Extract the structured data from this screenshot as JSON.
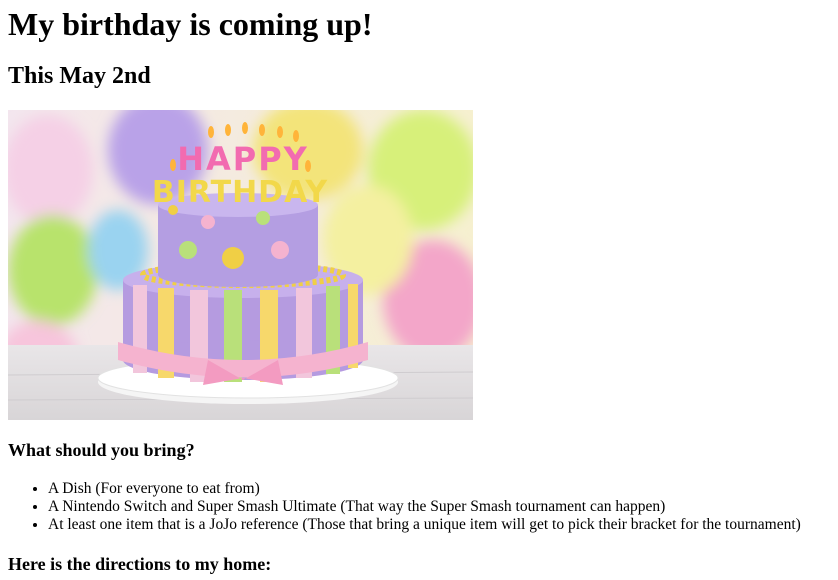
{
  "header": {
    "title": "My birthday is coming up!",
    "subtitle": "This May 2nd"
  },
  "hero_image": {
    "icon": "birthday-cake-image",
    "candle_text_top": "HAPPY",
    "candle_text_bottom": "BIRTHDAY"
  },
  "bring_section": {
    "heading": "What should you bring?",
    "items": [
      "A Dish (For everyone to eat from)",
      "A Nintendo Switch and Super Smash Ultimate (That way the Super Smash tournament can happen)",
      "At least one item that is a JoJo reference (Those that bring a unique item will get to pick their bracket for the tournament)"
    ]
  },
  "directions_section": {
    "heading": "Here is the directions to my home:"
  }
}
